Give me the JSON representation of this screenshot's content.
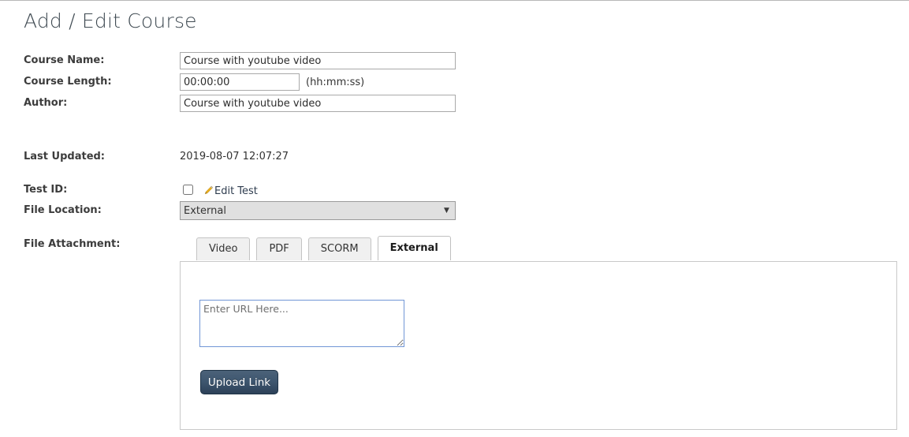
{
  "page": {
    "title": "Add / Edit Course"
  },
  "form": {
    "course_name": {
      "label": "Course Name:",
      "value": "Course with youtube video"
    },
    "course_length": {
      "label": "Course Length:",
      "value": "00:00:00",
      "hint": "(hh:mm:ss)"
    },
    "author": {
      "label": "Author:",
      "value": "Course with youtube video"
    },
    "last_updated": {
      "label": "Last Updated:",
      "value": "2019-08-07 12:07:27"
    },
    "test_id": {
      "label": "Test ID:",
      "checked": false,
      "edit_link": "Edit Test",
      "edit_icon": "pencil-icon"
    },
    "file_location": {
      "label": "File Location:",
      "selected": "External",
      "options": [
        "External"
      ],
      "arrow_icon": "chevron-down-icon"
    },
    "file_attachment": {
      "label": "File Attachment:"
    }
  },
  "tabs": [
    {
      "label": "Video",
      "active": false
    },
    {
      "label": "PDF",
      "active": false
    },
    {
      "label": "SCORM",
      "active": false
    },
    {
      "label": "External",
      "active": true
    }
  ],
  "external_panel": {
    "url_value": "",
    "url_placeholder": "Enter URL Here...",
    "upload_button": "Upload Link"
  },
  "colors": {
    "accent_button_top": "#4c6279",
    "accent_button_bottom": "#2d4158",
    "focus_border": "#7196d6",
    "pencil": "#f3b41b",
    "title": "#3f4a52"
  }
}
